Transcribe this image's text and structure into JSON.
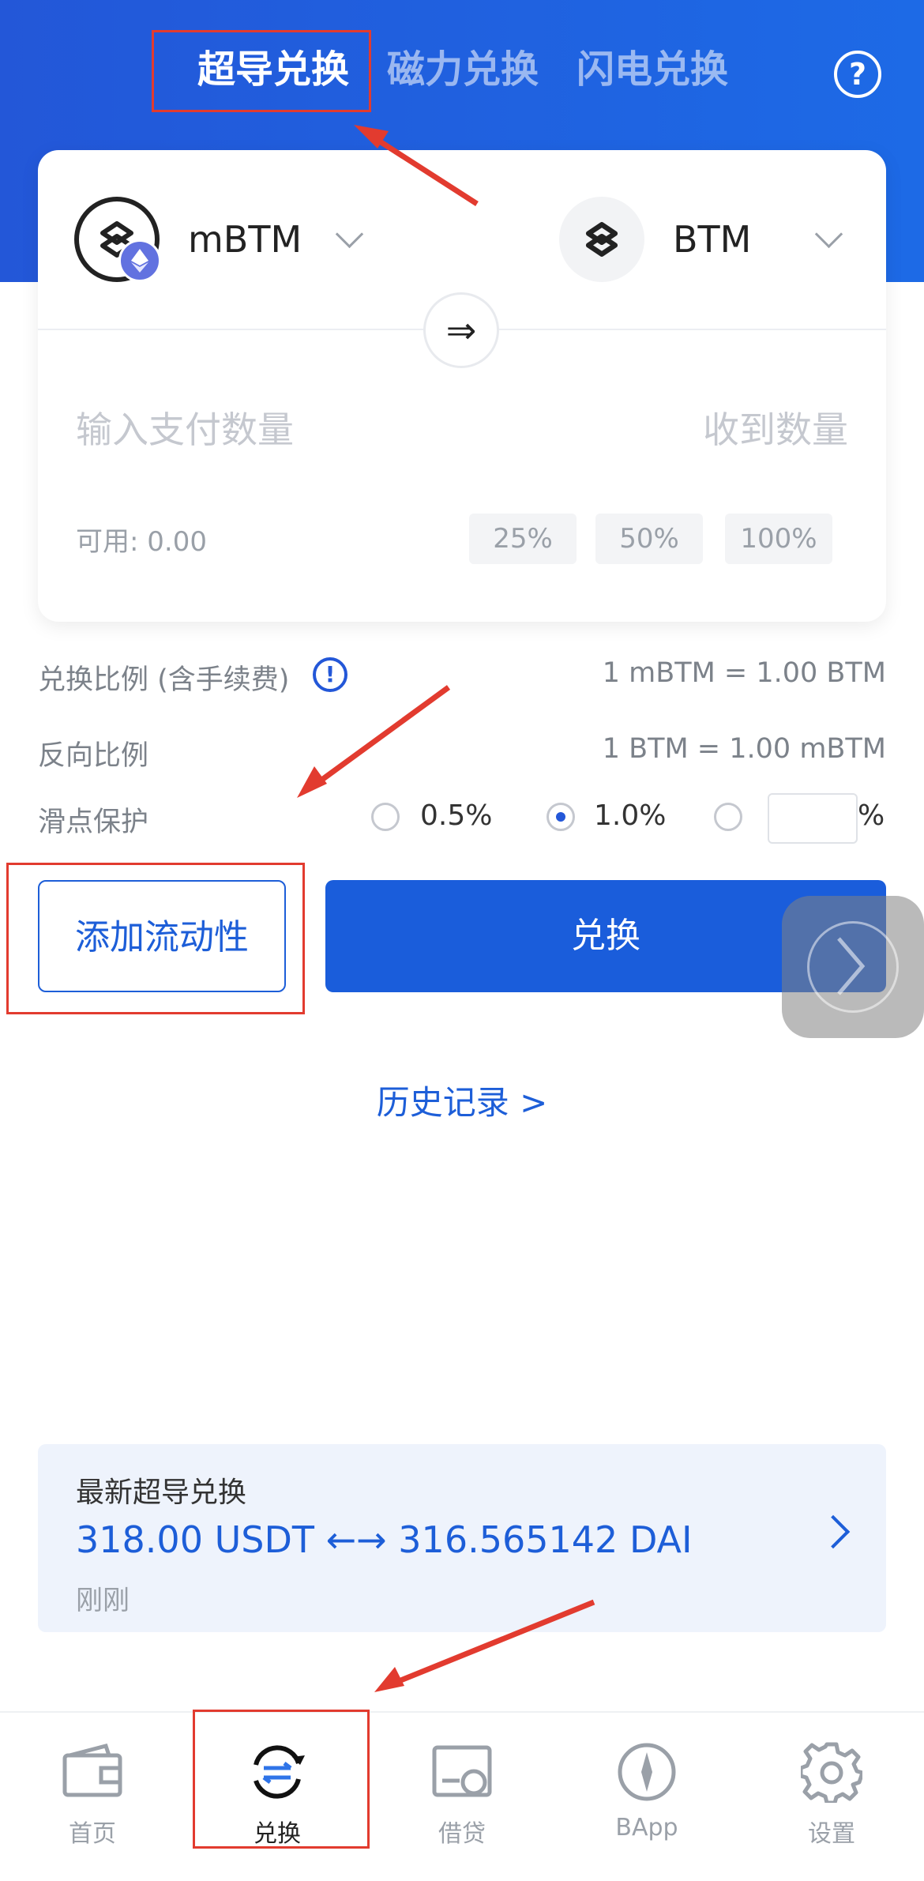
{
  "tabs": [
    {
      "label": "超导兑换",
      "active": true
    },
    {
      "label": "磁力兑换",
      "active": false
    },
    {
      "label": "闪电兑换",
      "active": false
    }
  ],
  "help_icon": "help-circle-icon",
  "pay_token": {
    "name": "mBTM",
    "icon": "mbtm-token-icon"
  },
  "receive_token": {
    "name": "BTM",
    "icon": "btm-token-icon"
  },
  "swap_direction_icon": "⇒",
  "pay_placeholder": "输入支付数量",
  "receive_placeholder": "收到数量",
  "available": "可用: 0.00",
  "percent_buttons": [
    "25%",
    "50%",
    "100%"
  ],
  "rate": {
    "label": "兑换比例 (含手续费)",
    "value": "1 mBTM = 1.00 BTM"
  },
  "reverse_rate": {
    "label": "反向比例",
    "value": "1 BTM = 1.00 mBTM"
  },
  "slippage": {
    "label": "滑点保护",
    "options": [
      "0.5%",
      "1.0%"
    ],
    "selected": "1.0%",
    "custom_value": "",
    "unit": "%"
  },
  "add_liquidity_label": "添加流动性",
  "swap_button_label": "兑换",
  "history_link": "历史记录 >",
  "latest": {
    "title": "最新超导兑换",
    "pair": "318.00 USDT ←→ 316.565142 DAI",
    "time": "刚刚"
  },
  "tabbar": [
    {
      "label": "首页",
      "icon": "wallet-icon",
      "active": false
    },
    {
      "label": "兑换",
      "icon": "swap-cycle-icon",
      "active": true
    },
    {
      "label": "借贷",
      "icon": "loan-icon",
      "active": false
    },
    {
      "label": "BApp",
      "icon": "compass-icon",
      "active": false
    },
    {
      "label": "设置",
      "icon": "gear-icon",
      "active": false
    }
  ],
  "colors": {
    "primary": "#1a5ddb",
    "annotation": "#e23b2f"
  }
}
